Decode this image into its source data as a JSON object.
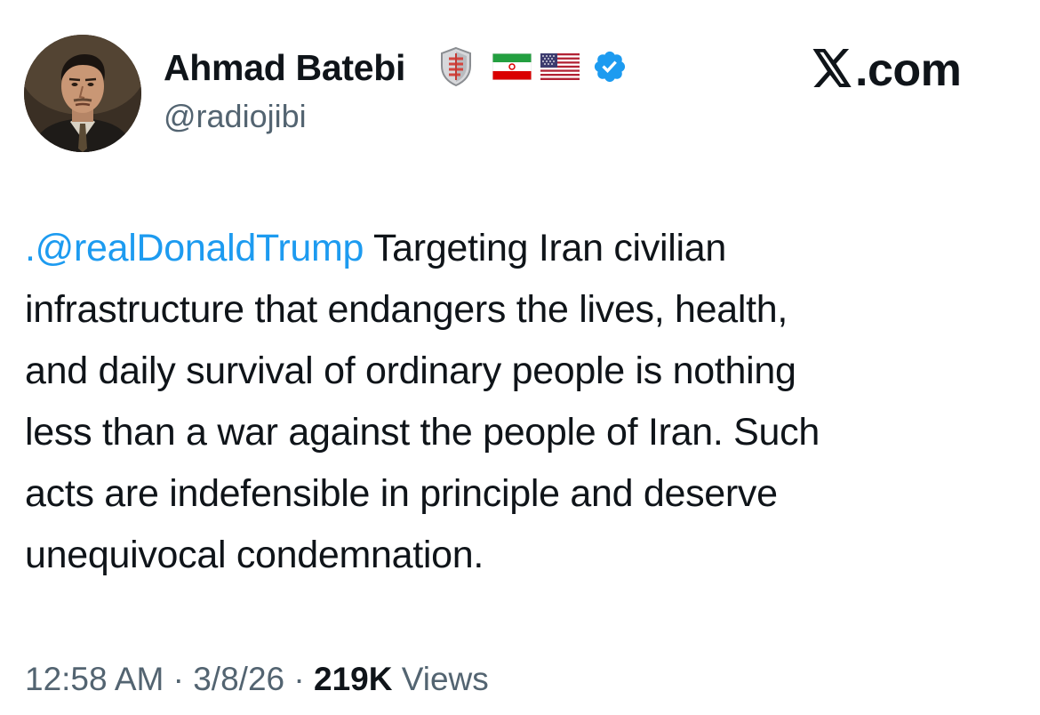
{
  "author": {
    "display_name": "Ahmad Batebi",
    "handle": "@radiojibi",
    "badges": [
      "shield-badge-icon",
      "iran-flag-icon",
      "us-flag-icon",
      "verified-badge-icon"
    ]
  },
  "brand": {
    "text": ".com",
    "logo_icon": "x-logo-icon"
  },
  "tweet": {
    "mention": ".@realDonaldTrump",
    "lines": [
      " Targeting Iran civilian",
      "infrastructure that endangers the lives, health,",
      "and daily survival of ordinary people is nothing",
      "less than a war against the people of Iran. Such",
      "acts are indefensible in principle and deserve",
      "unequivocal condemnation."
    ]
  },
  "meta": {
    "time": "12:58 AM",
    "separator": " · ",
    "date": "3/8/26",
    "views_count": "219K",
    "views_label": " Views"
  },
  "colors": {
    "text": "#0f1419",
    "secondary": "#536471",
    "link": "#1d9bf0",
    "verified": "#1d9bf0"
  }
}
